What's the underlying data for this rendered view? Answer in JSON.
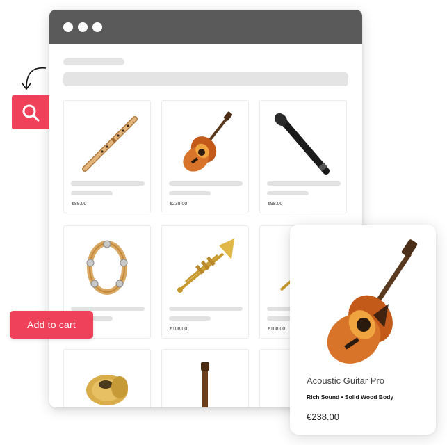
{
  "window": {
    "title_dots": [
      "close",
      "minimize",
      "maximize"
    ]
  },
  "products": [
    {
      "icon": "flute-icon",
      "price": "€88.00"
    },
    {
      "icon": "acoustic-guitar-icon",
      "price": "€238.00"
    },
    {
      "icon": "microphone-icon",
      "price": "€98.00"
    },
    {
      "icon": "tambourine-icon",
      "price": ""
    },
    {
      "icon": "trumpet-icon",
      "price": "€108.00"
    },
    {
      "icon": "trumpet-icon",
      "price": "€108.00"
    },
    {
      "icon": "cymbal-icon",
      "price": ""
    },
    {
      "icon": "guitar-neck-icon",
      "price": ""
    },
    {
      "icon": "",
      "price": ""
    }
  ],
  "search_button": {
    "icon": "search-icon"
  },
  "add_to_cart": {
    "label": "Add to cart"
  },
  "detail_card": {
    "name": "Acoustic Guitar Pro",
    "subtitle": "Rich Sound • Solid Wood Body",
    "price": "€238.00"
  },
  "colors": {
    "accent": "#ef4159",
    "titlebar": "#5a5a5a",
    "skeleton": "#e4e4e4"
  }
}
